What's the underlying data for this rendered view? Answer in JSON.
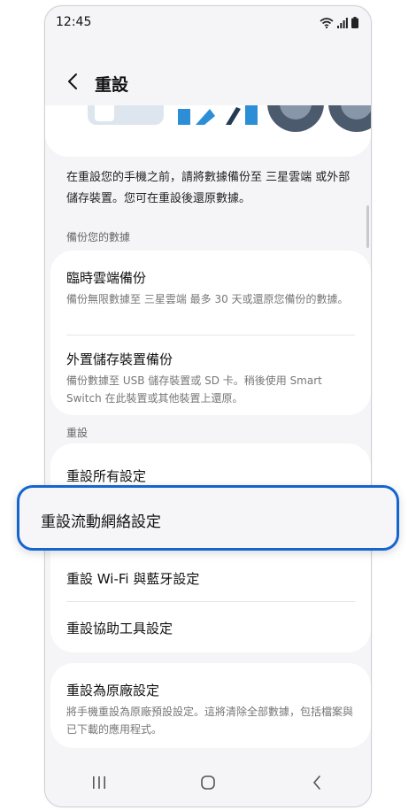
{
  "status_bar": {
    "time": "12:45"
  },
  "header": {
    "title": "重設"
  },
  "description": "在重設您的手機之前，請將數據備份至 三星雲端 或外部儲存裝置。您可在重設後還原數據。",
  "backup_section": {
    "label": "備份您的數據",
    "items": [
      {
        "title": "臨時雲端備份",
        "subtitle": "備份無限數據至 三星雲端 最多 30 天或還原您備份的數據。"
      },
      {
        "title": "外置儲存裝置備份",
        "subtitle": "備份數據至 USB 儲存裝置或 SD 卡。稍後使用 Smart Switch 在此裝置或其他裝置上還原。"
      }
    ]
  },
  "reset_section": {
    "label": "重設",
    "items": [
      {
        "title": "重設所有設定"
      },
      {
        "title": "重設流動網絡設定"
      },
      {
        "title": "重設 Wi-Fi 與藍牙設定"
      },
      {
        "title": "重設協助工具設定"
      }
    ]
  },
  "factory_reset": {
    "title": "重設為原廠設定",
    "subtitle": "將手機重設為原廠預設設定。這將清除全部數據，包括檔案與已下載的應用程式。"
  },
  "colors": {
    "highlight_border": "#1565d0",
    "background": "#f5f5f7",
    "card": "#ffffff"
  }
}
